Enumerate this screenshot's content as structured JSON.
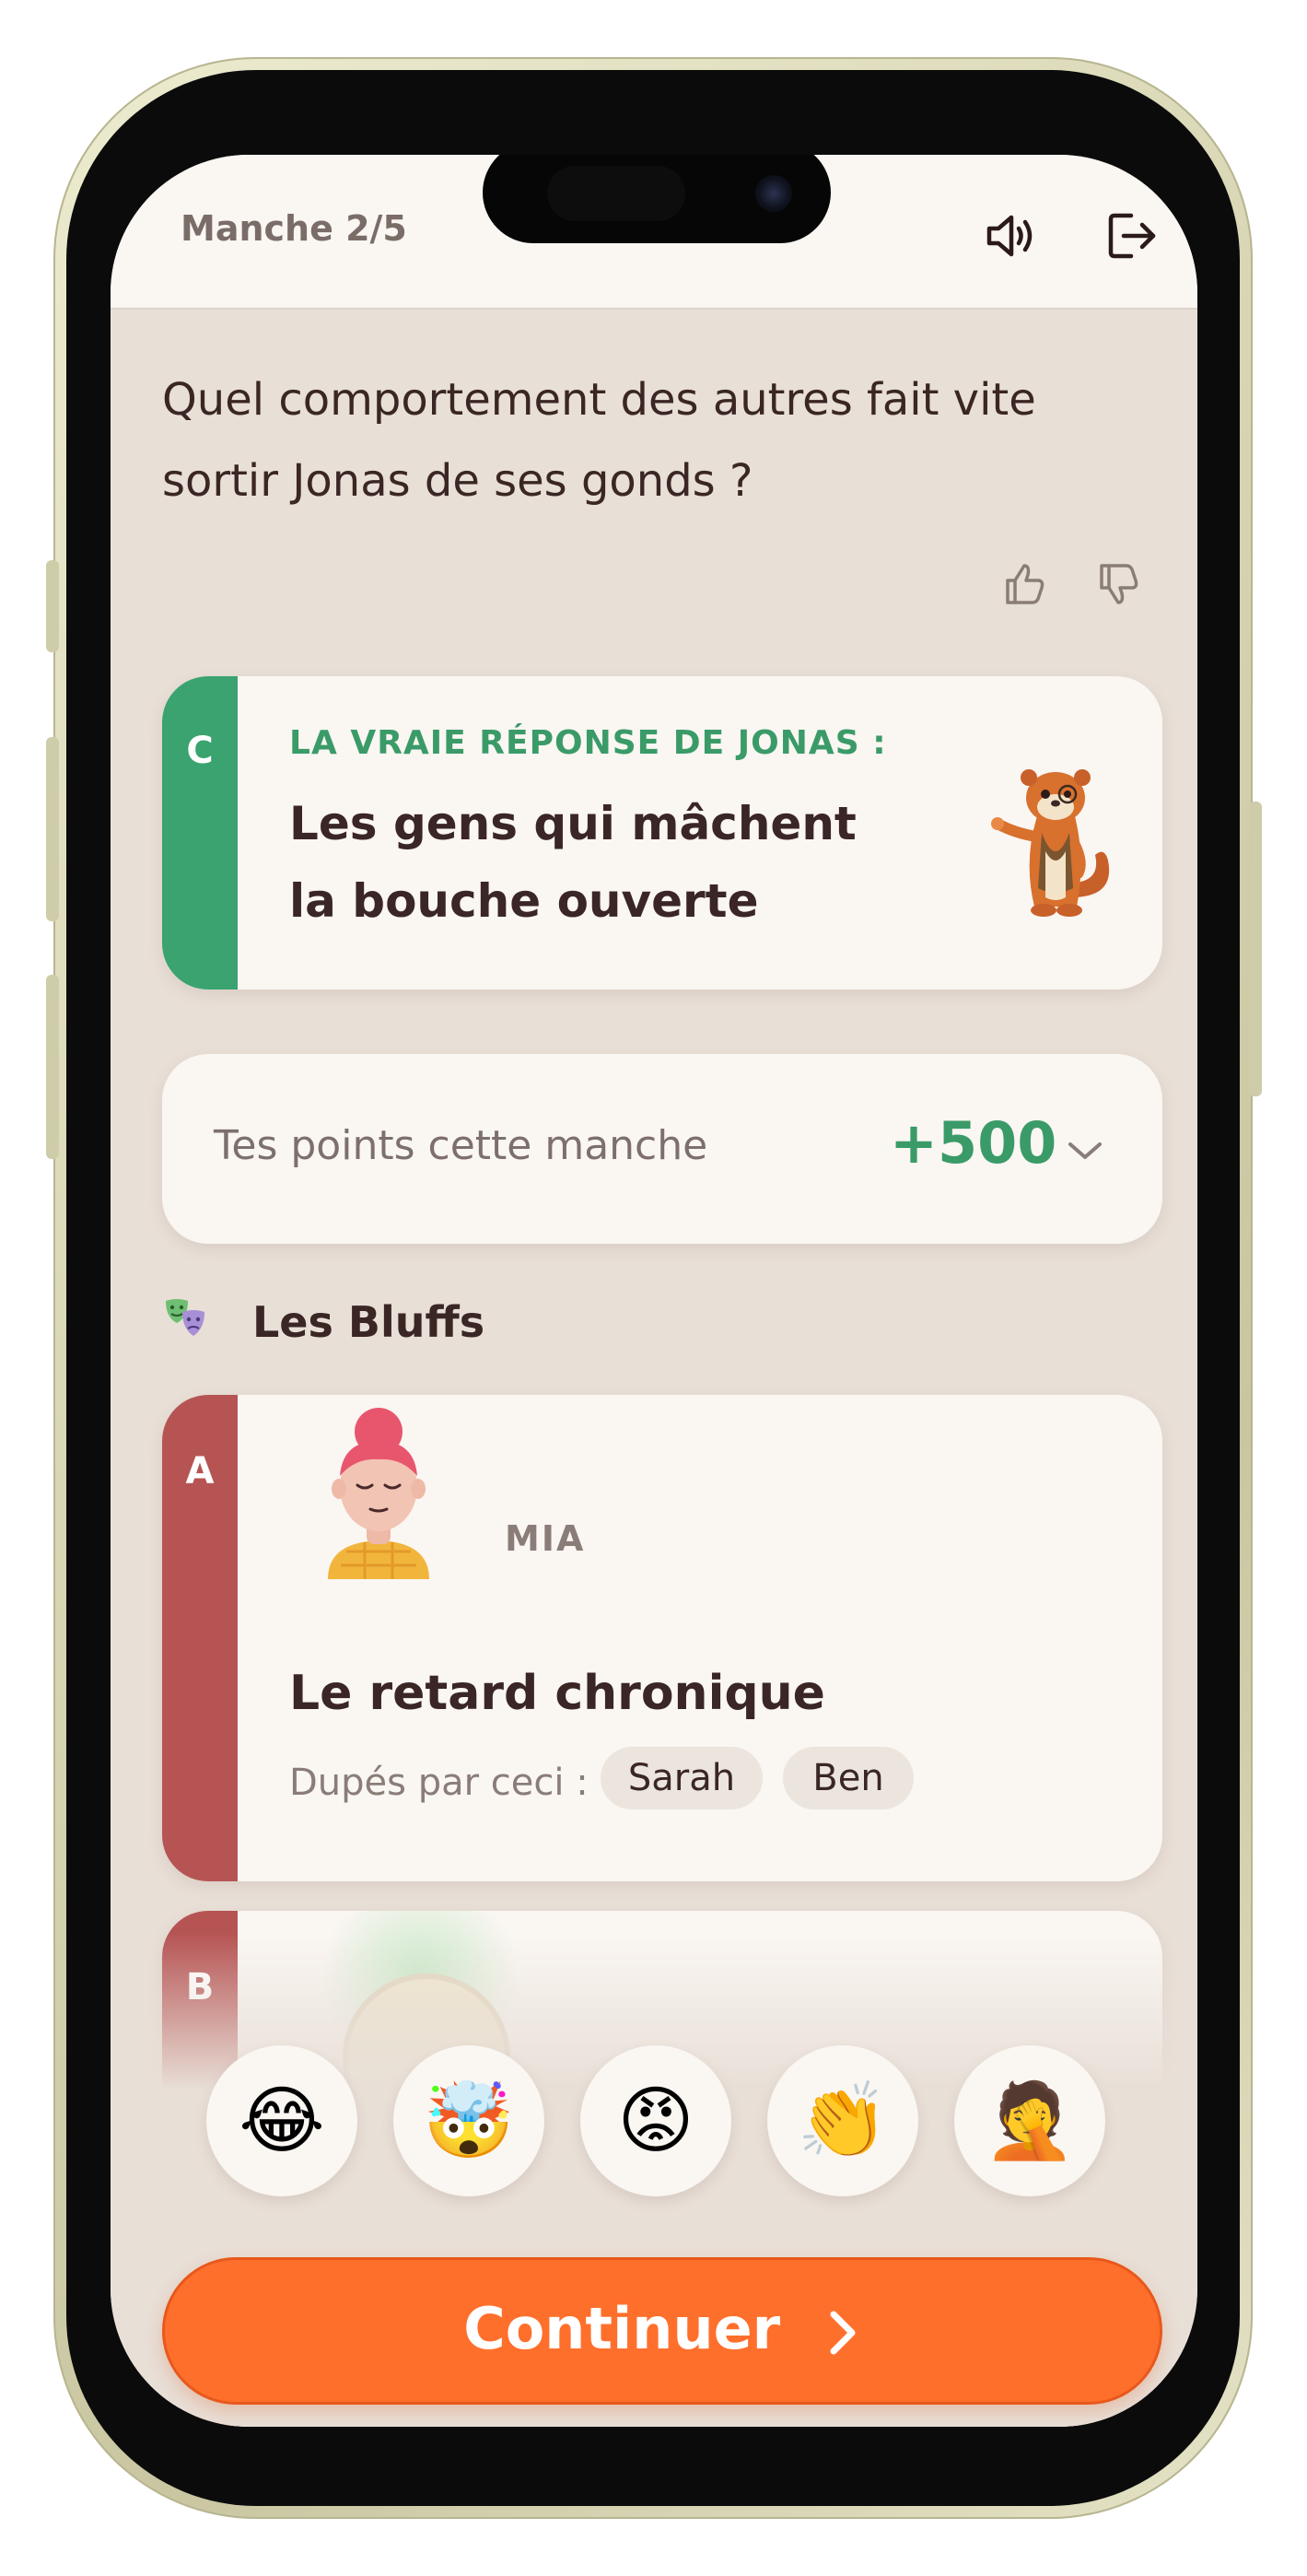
{
  "header": {
    "round": "Manche 2/5",
    "sound_icon": "speaker-icon",
    "exit_icon": "exit-icon"
  },
  "question": {
    "text": "Quel comportement des autres fait vite sortir Jonas de ses gonds ?"
  },
  "feedback": {
    "like_icon": "thumbs-up-icon",
    "dislike_icon": "thumbs-down-icon"
  },
  "truth_card": {
    "letter": "C",
    "title": "LA VRAIE RÉPONSE DE JONAS :",
    "answer": "Les gens qui mâchent la bouche ouverte",
    "accent": "#3aa36f"
  },
  "points": {
    "label": "Tes points cette manche",
    "value": "+500",
    "chevron_icon": "chevron-down-icon"
  },
  "bluffs": {
    "title": "Les Bluffs",
    "icon": "theater-masks-icon",
    "items": [
      {
        "letter": "A",
        "player": "MIA",
        "answer": "Le retard chronique",
        "duped_label": "Dupés par ceci :",
        "duped": [
          "Sarah",
          "Ben"
        ],
        "accent": "#b65454"
      },
      {
        "letter": "B",
        "accent": "#b65454"
      }
    ]
  },
  "reactions": [
    {
      "emoji": "😂",
      "name": "laughing-emoji"
    },
    {
      "emoji": "🤯",
      "name": "mind-blown-emoji"
    },
    {
      "emoji": "😡",
      "name": "angry-emoji"
    },
    {
      "emoji": "👏",
      "name": "clapping-emoji"
    },
    {
      "emoji": "🤦",
      "name": "facepalm-emoji"
    }
  ],
  "continue": {
    "label": "Continuer",
    "icon": "chevron-right-icon"
  }
}
